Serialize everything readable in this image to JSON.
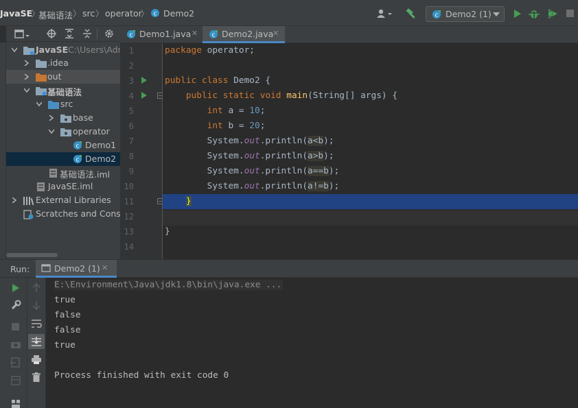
{
  "navbar": {
    "breadcrumbs": [
      "JavaSE",
      "基础语法",
      "src",
      "operator",
      "Demo2"
    ],
    "run_config": "Demo2 (1)"
  },
  "colors": {
    "accent_blue": "#4a88c7",
    "run_green": "#499c54",
    "build_green": "#59a869",
    "folder_orange": "#c57633"
  },
  "project": {
    "tree": [
      {
        "label": "JavaSE",
        "hint": "C:\\Users\\Adn",
        "icon": "module-folder-icon"
      },
      {
        "label": ".idea",
        "icon": "folder-icon"
      },
      {
        "label": "out",
        "icon": "excluded-folder-icon"
      },
      {
        "label": "基础语法",
        "icon": "module-folder-icon"
      },
      {
        "label": "src",
        "icon": "source-folder-icon"
      },
      {
        "label": "base",
        "icon": "package-icon"
      },
      {
        "label": "operator",
        "icon": "package-icon"
      },
      {
        "label": "Demo1",
        "icon": "java-class-icon"
      },
      {
        "label": "Demo2",
        "icon": "java-class-icon"
      },
      {
        "label": "基础语法.iml",
        "icon": "iml-file-icon"
      },
      {
        "label": "JavaSE.iml",
        "icon": "iml-file-icon"
      },
      {
        "label": "External Libraries",
        "icon": "libraries-icon"
      },
      {
        "label": "Scratches and Conso",
        "icon": "scratches-icon"
      }
    ]
  },
  "editor": {
    "tabs": [
      {
        "label": "Demo1.java",
        "active": false
      },
      {
        "label": "Demo2.java",
        "active": true
      }
    ],
    "line_numbers": [
      "1",
      "2",
      "3",
      "4",
      "5",
      "6",
      "7",
      "8",
      "9",
      "10",
      "11",
      "12",
      "13",
      "14"
    ]
  },
  "run": {
    "title": "Run:",
    "tab_label": "Demo2 (1)",
    "output": [
      "E:\\Environment\\Java\\jdk1.8\\bin\\java.exe ...",
      "true",
      "false",
      "false",
      "true",
      "",
      "Process finished with exit code 0"
    ]
  }
}
